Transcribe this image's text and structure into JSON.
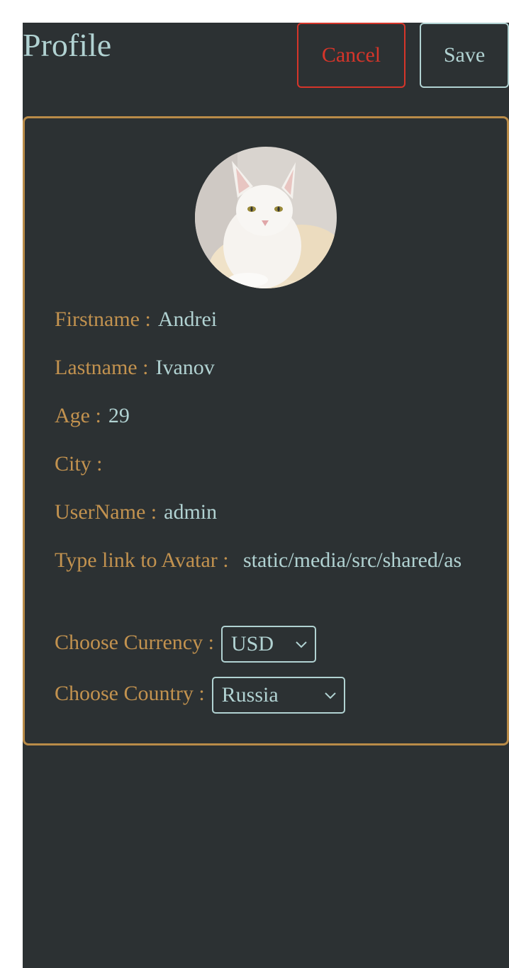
{
  "header": {
    "title": "Profile",
    "cancel_label": "Cancel",
    "save_label": "Save"
  },
  "profile": {
    "avatar_icon": "cat-avatar-photo",
    "fields": {
      "firstname": {
        "label": "Firstname :",
        "value": "Andrei"
      },
      "lastname": {
        "label": "Lastname :",
        "value": "Ivanov"
      },
      "age": {
        "label": "Age :",
        "value": "29"
      },
      "city": {
        "label": "City :",
        "value": ""
      },
      "username": {
        "label": "UserName :",
        "value": "admin"
      },
      "avatar_link": {
        "label": "Type link to Avatar :",
        "value": "static/media/src/shared/as"
      }
    },
    "currency": {
      "label": "Choose Currency :",
      "selected": "USD"
    },
    "country": {
      "label": "Choose Country :",
      "selected": "Russia"
    }
  },
  "colors": {
    "background": "#2c3133",
    "accent_text": "#b1d2d2",
    "label": "#c2924f",
    "card_border": "#b98b48",
    "cancel": "#d6352a"
  }
}
